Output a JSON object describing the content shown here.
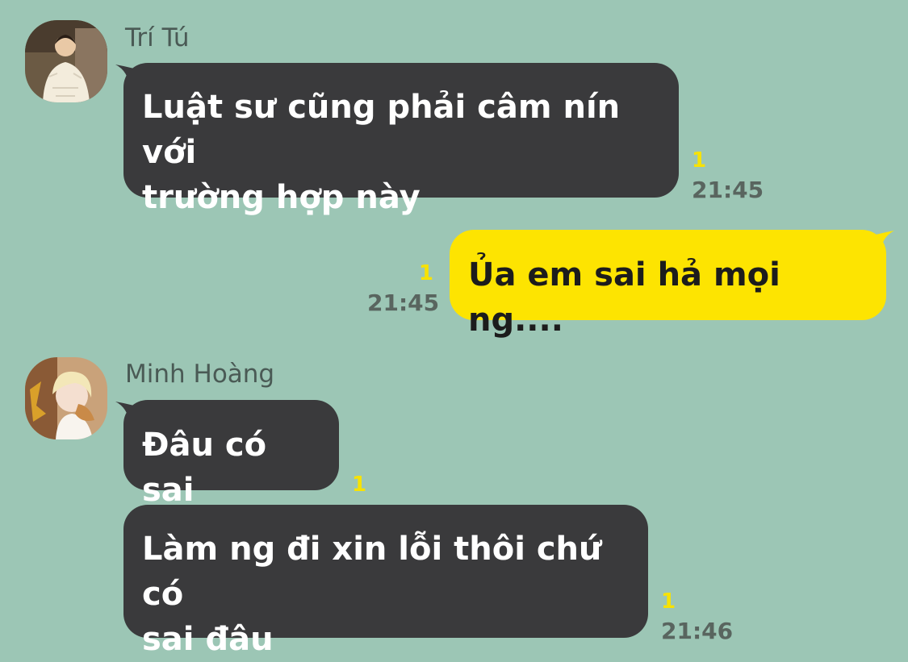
{
  "chat": {
    "background_color": "#9cc6b5",
    "incoming_bubble_color": "#3a3a3c",
    "outgoing_bubble_color": "#fde401",
    "unread_color": "#f7e204",
    "messages": [
      {
        "direction": "incoming",
        "sender": "Trí Tú",
        "avatar": "photo",
        "lines": [
          "Luật sư cũng phải câm nín với",
          "trường hợp này"
        ],
        "unread": "1",
        "time": "21:45"
      },
      {
        "direction": "outgoing",
        "lines": [
          "Ủa em sai hả mọi ng...."
        ],
        "unread": "1",
        "time": "21:45"
      },
      {
        "direction": "incoming",
        "sender": "Minh Hoàng",
        "avatar": "photo",
        "lines": [
          "Đâu có sai"
        ],
        "unread": "1"
      },
      {
        "direction": "incoming",
        "lines": [
          "Làm ng đi xin lỗi thôi chứ có",
          "sai đâu"
        ],
        "unread": "1",
        "time": "21:46"
      }
    ]
  }
}
